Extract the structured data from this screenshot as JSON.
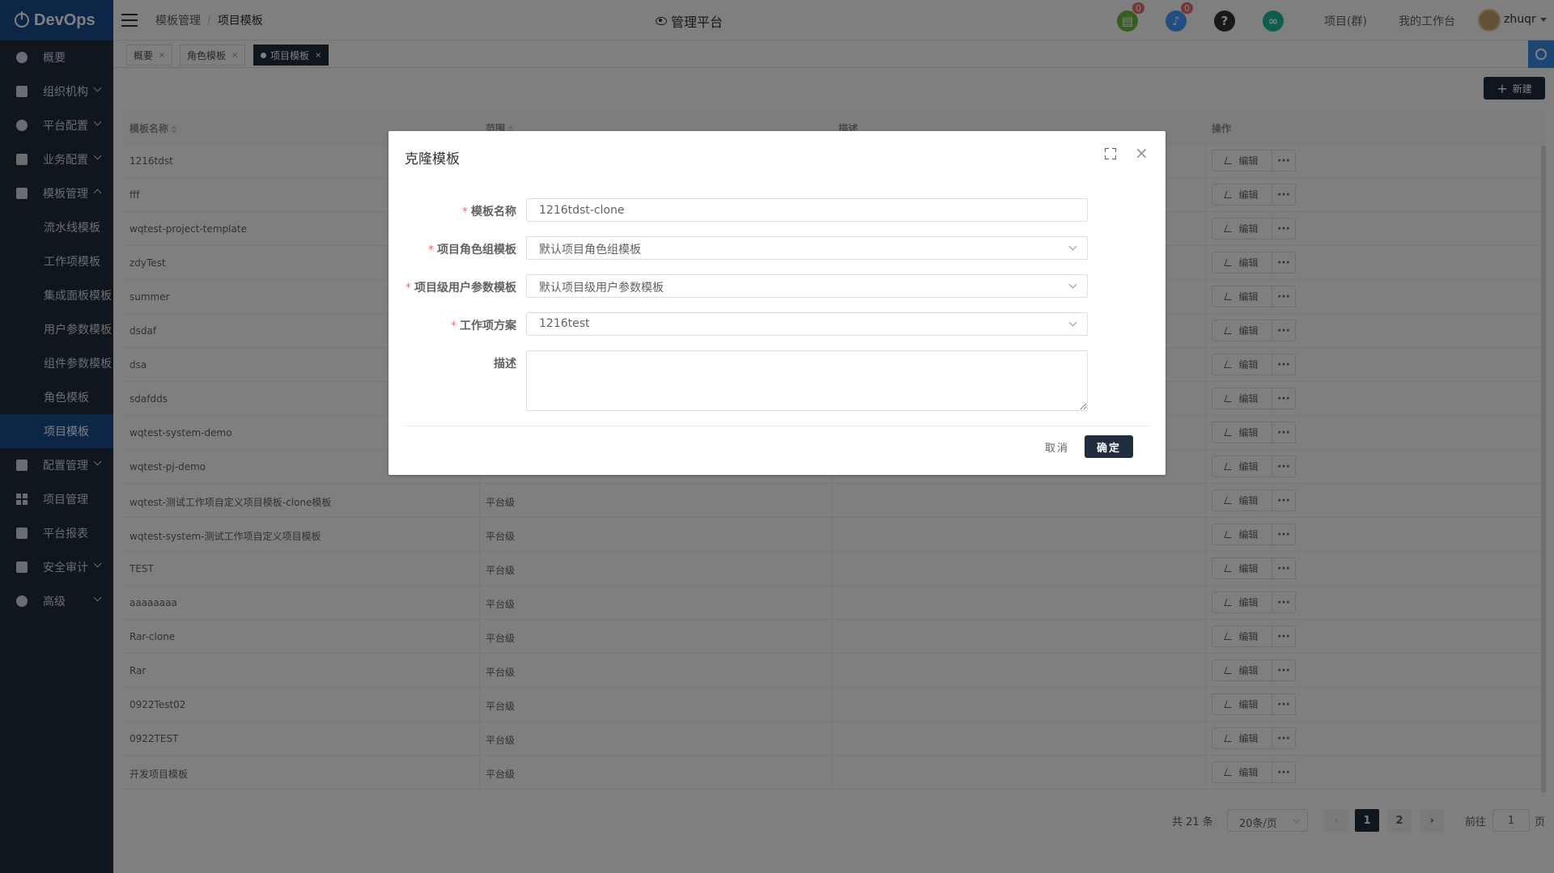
{
  "app": {
    "name": "DevOps",
    "platform_title": "管理平台"
  },
  "breadcrumb": {
    "parent": "模板管理",
    "current": "项目模板"
  },
  "header": {
    "badge_tasks": "0",
    "badge_notifications": "0",
    "help_glyph": "?",
    "link_project_group": "项目(群)",
    "link_workbench": "我的工作台",
    "username": "zhuqr"
  },
  "sidebar": {
    "items": [
      {
        "label": "概要"
      },
      {
        "label": "组织机构"
      },
      {
        "label": "平台配置"
      },
      {
        "label": "业务配置"
      },
      {
        "label": "模板管理"
      },
      {
        "label": "配置管理"
      },
      {
        "label": "项目管理"
      },
      {
        "label": "平台报表"
      },
      {
        "label": "安全审计"
      },
      {
        "label": "高级"
      }
    ],
    "sub_items": [
      {
        "label": "流水线模板"
      },
      {
        "label": "工作项模板"
      },
      {
        "label": "集成面板模板"
      },
      {
        "label": "用户参数模板"
      },
      {
        "label": "组件参数模板"
      },
      {
        "label": "角色模板"
      },
      {
        "label": "项目模板"
      }
    ]
  },
  "tabs": [
    {
      "label": "概要",
      "close": "×"
    },
    {
      "label": "角色模板",
      "close": "×"
    },
    {
      "label": "项目模板",
      "close": "×"
    }
  ],
  "toolbar": {
    "new_label": "新建",
    "new_icon": "+"
  },
  "table": {
    "headers": {
      "name": "模板名称",
      "scope": "范围",
      "desc": "描述",
      "ops": "操作"
    },
    "edit_label": "编辑",
    "more_label": "···",
    "rows": [
      {
        "name": "1216tdst",
        "scope": ""
      },
      {
        "name": "fff",
        "scope": ""
      },
      {
        "name": "wqtest-project-template",
        "scope": ""
      },
      {
        "name": "zdyTest",
        "scope": ""
      },
      {
        "name": "summer",
        "scope": ""
      },
      {
        "name": "dsdaf",
        "scope": ""
      },
      {
        "name": "dsa",
        "scope": ""
      },
      {
        "name": "sdafdds",
        "scope": ""
      },
      {
        "name": "wqtest-system-demo",
        "scope": ""
      },
      {
        "name": "wqtest-pj-demo",
        "scope": ""
      },
      {
        "name": "wqtest-测试工作项自定义项目模板-clone模板",
        "scope": "平台级"
      },
      {
        "name": "wqtest-system-测试工作项自定义项目模板",
        "scope": "平台级"
      },
      {
        "name": "TEST",
        "scope": "平台级"
      },
      {
        "name": "aaaaaaaa",
        "scope": "平台级"
      },
      {
        "name": "Rar-clone",
        "scope": "平台级"
      },
      {
        "name": "Rar",
        "scope": "平台级"
      },
      {
        "name": "0922Test02",
        "scope": "平台级"
      },
      {
        "name": "0922TEST",
        "scope": "平台级"
      },
      {
        "name": "开发项目模板",
        "scope": "平台级"
      }
    ]
  },
  "pagination": {
    "total": "共 21 条",
    "page_size": "20条/页",
    "prev": "‹",
    "pages": [
      "1",
      "2"
    ],
    "next": "›",
    "goto_label": "前往",
    "goto_value": "1",
    "page_suffix": "页"
  },
  "dialog": {
    "title": "克隆模板",
    "close": "×",
    "fields": {
      "name": {
        "label": "模板名称",
        "value": "1216tdst-clone"
      },
      "role_group": {
        "label": "项目角色组模板",
        "value": "默认项目角色组模板"
      },
      "user_params": {
        "label": "项目级用户参数模板",
        "value": "默认项目级用户参数模板"
      },
      "workitem": {
        "label": "工作项方案",
        "value": "1216test"
      },
      "desc": {
        "label": "描述",
        "value": ""
      }
    },
    "required_mark": "*",
    "cancel_label": "取消",
    "ok_label": "确定"
  },
  "colors": {
    "sidebar_bg": "#1f2d3d",
    "accent": "#1b4a8e",
    "task_icon": "#67c23a",
    "bell_icon": "#409eff",
    "help_icon": "#303133",
    "link_icon": "#1abc9c"
  }
}
